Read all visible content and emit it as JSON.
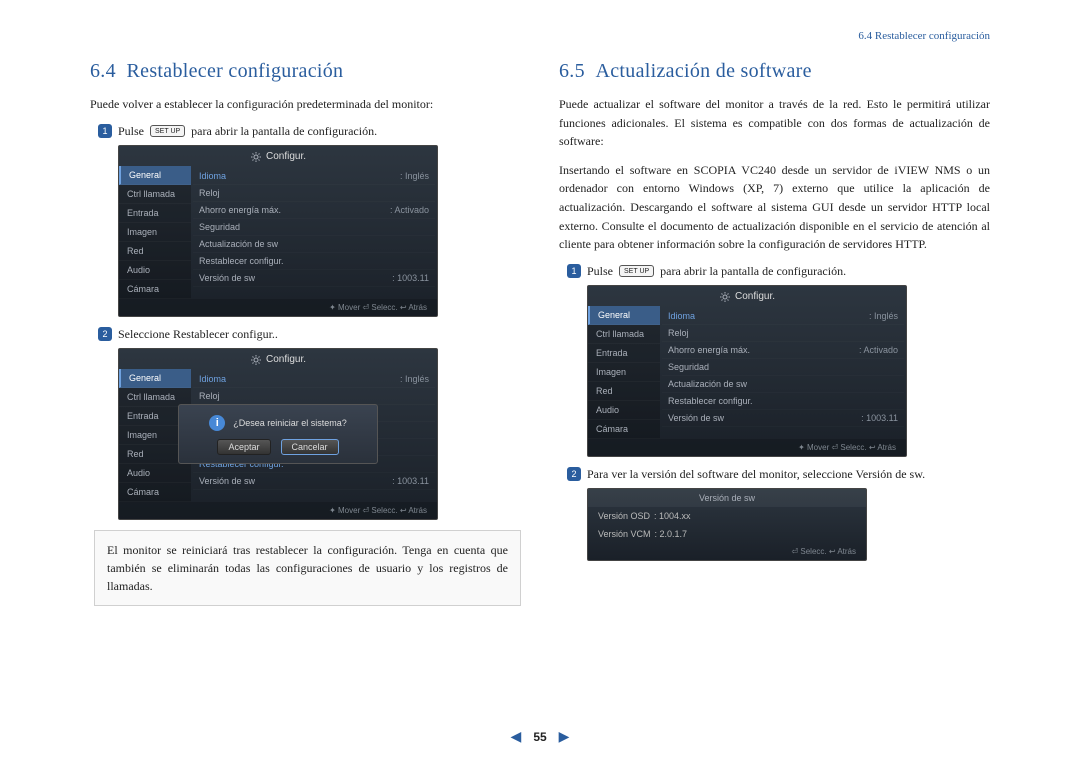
{
  "header": {
    "breadcrumb": "6.4 Restablecer configuración"
  },
  "left": {
    "heading_num": "6.4",
    "heading_title": "Restablecer configuración",
    "intro": "Puede volver a establecer la configuración predeterminada del monitor:",
    "step1_pre": "Pulse",
    "step1_btn": "SET UP",
    "step1_post": "para abrir la pantalla de configuración.",
    "step2": "Seleccione Restablecer configur..",
    "note": "El monitor se reiniciará tras restablecer la configuración. Tenga en cuenta que también se eliminarán todas las configuraciones de usuario y los registros de llamadas."
  },
  "right": {
    "heading_num": "6.5",
    "heading_title": "Actualización de software",
    "intro": "Puede actualizar el software del monitor a través de la red. Esto le permitirá utilizar funciones adicionales. El sistema es compatible con dos formas de actualización de software:",
    "para2": "Insertando el software en SCOPIA VC240 desde un servidor de iVIEW NMS o un ordenador con entorno Windows (XP, 7) externo que utilice la aplicación de actualización. Descargando el software al sistema GUI desde un servidor HTTP local externo. Consulte el documento de actualización disponible en el servicio de atención al cliente para obtener información sobre la configuración de servidores HTTP.",
    "step1_pre": "Pulse",
    "step1_btn": "SET UP",
    "step1_post": "para abrir la pantalla de configuración.",
    "step2": "Para ver la versión del software del monitor, seleccione Versión de sw."
  },
  "configur": {
    "title": "Configur.",
    "side": [
      "General",
      "Ctrl llamada",
      "Entrada",
      "Imagen",
      "Red",
      "Audio",
      "Cámara"
    ],
    "rows": [
      {
        "label": "Idioma",
        "value": ": Inglés"
      },
      {
        "label": "Reloj",
        "value": ""
      },
      {
        "label": "Ahorro energía máx.",
        "value": ": Activado"
      },
      {
        "label": "Seguridad",
        "value": ""
      },
      {
        "label": "Actualización de sw",
        "value": ""
      },
      {
        "label": "Restablecer configur.",
        "value": ""
      },
      {
        "label": "Versión de sw",
        "value": ": 1003.11"
      }
    ],
    "footer": "✦ Mover   ⏎ Selecc.   ↩ Atrás"
  },
  "dialog": {
    "message": "¿Desea reiniciar el sistema?",
    "ok": "Aceptar",
    "cancel": "Cancelar"
  },
  "swver": {
    "title": "Versión de sw",
    "osd_label": "Versión OSD",
    "osd_val": ": 1004.xx",
    "vcm_label": "Versión VCM",
    "vcm_val": ": 2.0.1.7",
    "footer": "⏎ Selecc.   ↩ Atrás"
  },
  "pagenum": "55"
}
